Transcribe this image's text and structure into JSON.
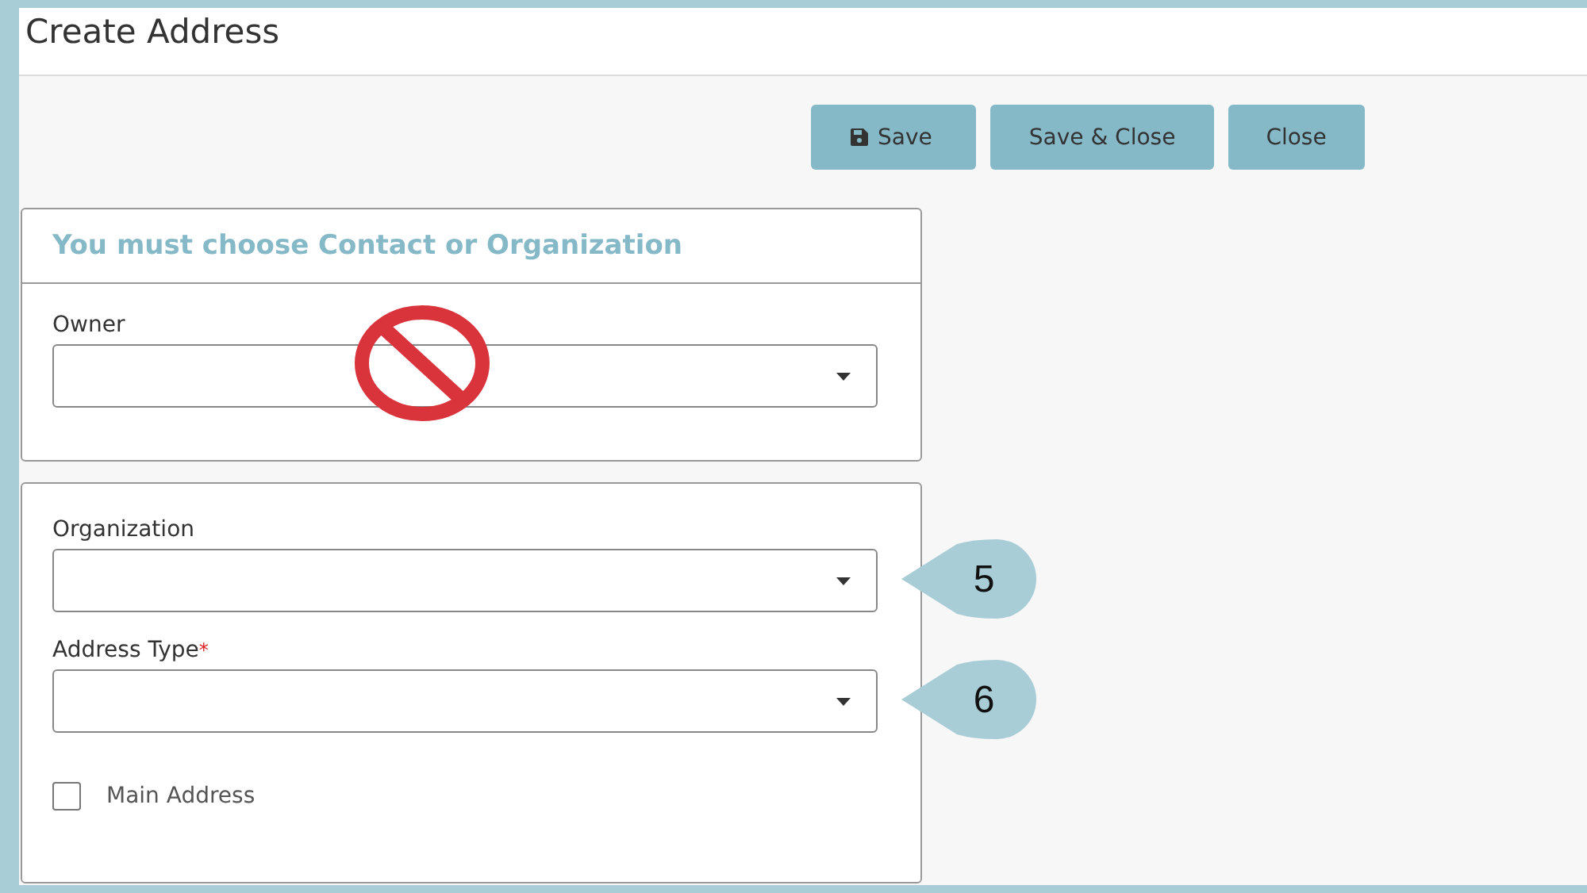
{
  "window": {
    "title": "Create Address"
  },
  "buttons": [
    {
      "label": "Save",
      "kind": "icon"
    },
    {
      "label": "Save & Close",
      "kind": "plain"
    },
    {
      "label": "Close",
      "kind": "plain"
    }
  ],
  "owner_panel": {
    "heading": "You must choose Contact or Organization",
    "fields": [
      {
        "label": "Owner",
        "blocked": true
      }
    ]
  },
  "details_panel": {
    "fields": [
      {
        "label": "Organization",
        "callout": "5"
      },
      {
        "label": "Address Type",
        "required_mark": "*",
        "callout": "6"
      }
    ],
    "checkbox": {
      "label": "Main Address",
      "checked": false
    }
  }
}
